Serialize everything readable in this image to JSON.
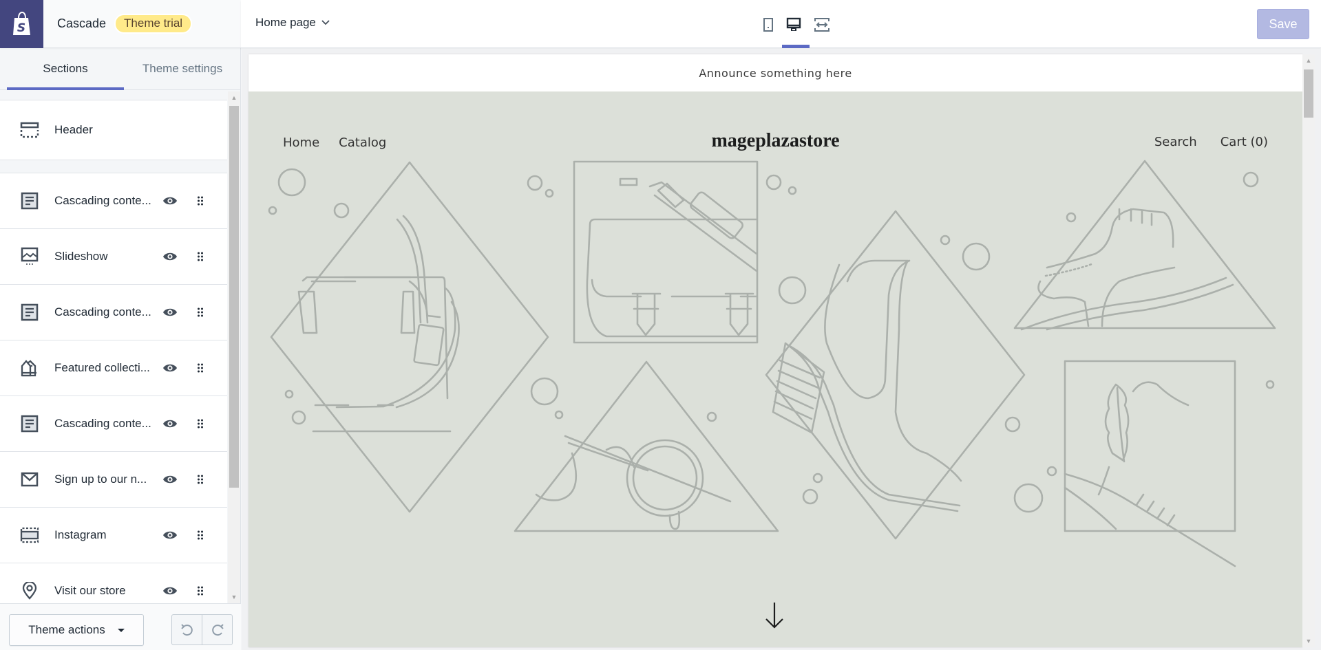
{
  "brand": {
    "store_theme_name": "Cascade",
    "badge": "Theme trial"
  },
  "sidebar": {
    "tabs": [
      {
        "label": "Sections",
        "active": true
      },
      {
        "label": "Theme settings",
        "active": false
      }
    ],
    "header_item": {
      "label": "Header",
      "icon": "header-layout-icon"
    },
    "sections": [
      {
        "label": "Cascading conte...",
        "icon": "text-block-icon",
        "visible": true
      },
      {
        "label": "Slideshow",
        "icon": "slideshow-icon",
        "visible": true
      },
      {
        "label": "Cascading conte...",
        "icon": "text-block-icon",
        "visible": true
      },
      {
        "label": "Featured collecti...",
        "icon": "collection-tags-icon",
        "visible": true
      },
      {
        "label": "Cascading conte...",
        "icon": "text-block-icon",
        "visible": true
      },
      {
        "label": "Sign up to our n...",
        "icon": "envelope-icon",
        "visible": true
      },
      {
        "label": "Instagram",
        "icon": "gallery-icon",
        "visible": true
      },
      {
        "label": "Visit our store",
        "icon": "location-pin-icon",
        "visible": true
      }
    ],
    "footer": {
      "theme_actions_label": "Theme actions"
    }
  },
  "topbar": {
    "page_selector": "Home page",
    "devices": [
      "mobile",
      "desktop",
      "full-width"
    ],
    "active_device": "desktop",
    "save_label": "Save",
    "save_enabled": false
  },
  "preview": {
    "announcement": "Announce something here",
    "nav_left": [
      "Home",
      "Catalog"
    ],
    "store_name": "mageplazastore",
    "nav_right": [
      "Search",
      "Cart (0)"
    ],
    "hero_bg_color": "#dce0d9",
    "illustration_color": "#abb0ab"
  },
  "colors": {
    "accent": "#5c6ac4",
    "brand_bg": "#43467f",
    "badge_bg": "#ffea8a",
    "save_disabled": "#b3b9e2"
  }
}
